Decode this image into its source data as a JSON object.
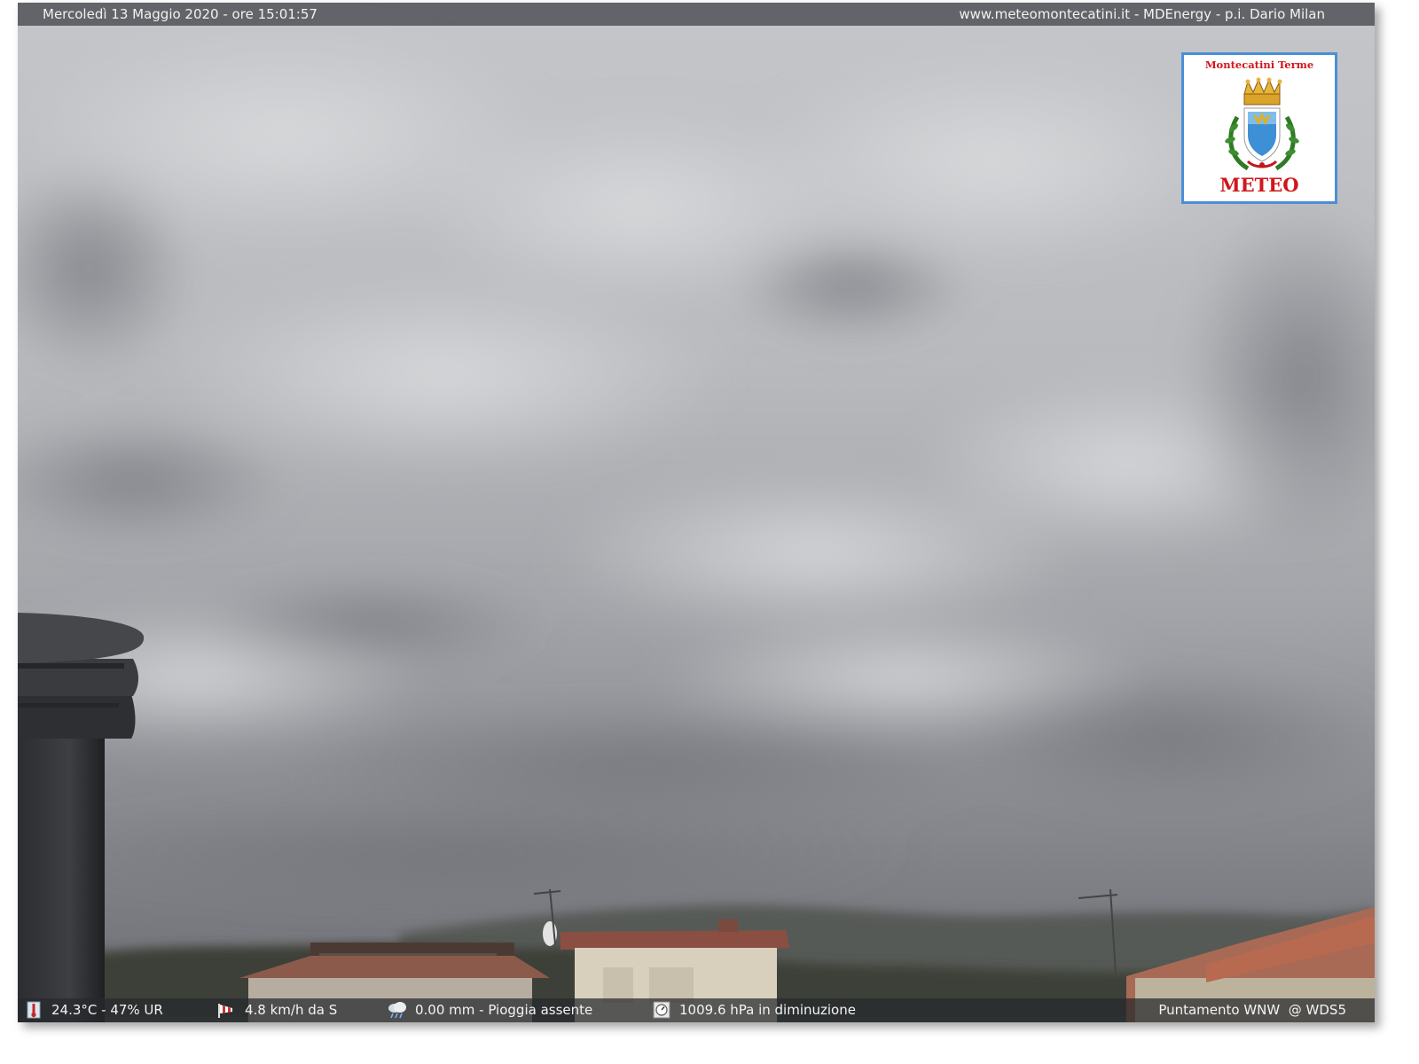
{
  "overlay": {
    "datetime": "Mercoledì 13 Maggio 2020 - ore 15:01:57",
    "credits": "www.meteomontecatini.it - MDEnergy - p.i. Dario Milan"
  },
  "logo": {
    "town": "Montecatini Terme",
    "meteo": "METEO"
  },
  "readings": {
    "temperature_humidity": "24.3°C - 47% UR",
    "wind": "4.8 km/h da S",
    "rain": "0.00 mm - Pioggia assente",
    "pressure": "1009.6 hPa in diminuzione",
    "pointing": "Puntamento WNW  @ WDS5"
  },
  "icons": {
    "temperature": "thermometer-icon",
    "wind": "windsock-icon",
    "rain": "rain-cloud-icon",
    "pressure": "barometer-icon"
  },
  "colors": {
    "brand_red": "#d0161c",
    "logo_border": "#4a8fd6"
  }
}
